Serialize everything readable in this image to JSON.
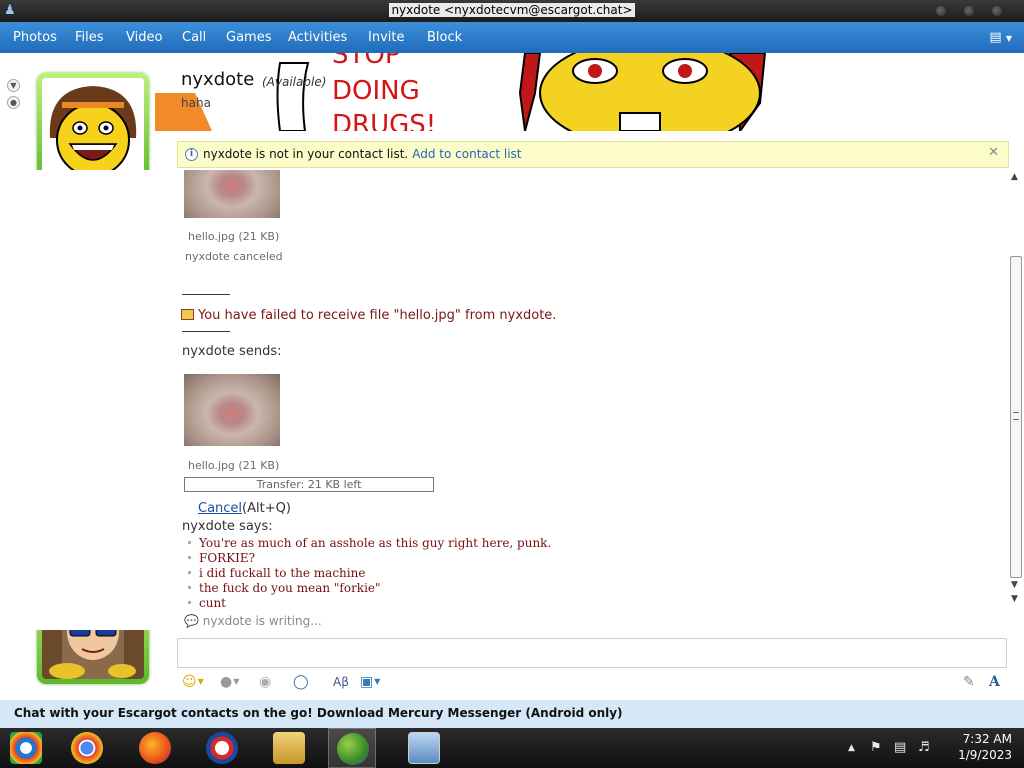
{
  "window": {
    "title": "nyxdote <nyxdotecvm@escargot.chat>"
  },
  "menu": {
    "items": [
      "Photos",
      "Files",
      "Video",
      "Call",
      "Games",
      "Activities",
      "Invite",
      "Block"
    ]
  },
  "contact": {
    "name": "nyxdote",
    "status": "(Available)",
    "personal_message": "haha"
  },
  "infobar": {
    "text": "nyxdote is not in your contact list.",
    "link": "Add to contact list"
  },
  "conversation": {
    "first_file": {
      "name": "hello.jpg (21 KB)",
      "status": "nyxdote canceled"
    },
    "error": "You have failed to receive file \"hello.jpg\" from nyxdote.",
    "sends_label": "nyxdote sends:",
    "second_file": {
      "name": "hello.jpg (21 KB)",
      "progress": "Transfer: 21 KB left"
    },
    "cancel_link": "Cancel",
    "cancel_shortcut": "(Alt+Q)",
    "says_label": "nyxdote says:",
    "messages": [
      "You're as much of an asshole as this guy right here, punk.",
      "FORKIE?",
      "i did fuckall to the machine",
      "the fuck do you mean \"forkie\"",
      "cunt"
    ],
    "typing": "nyxdote is writing..."
  },
  "banner_text": {
    "line1": "STOP",
    "line2": "DOING",
    "line3": "DRUGS!"
  },
  "promo": {
    "text": "Chat with your Escargot contacts on the go! Download Mercury Messenger (Android only)"
  },
  "taskbar": {
    "time": "7:32 AM",
    "date": "1/9/2023"
  },
  "colors": {
    "menu_blue": "#2a7bcc",
    "message_red": "#7a0e0e",
    "info_yellow": "#fcfcc9",
    "avatar_green": "#5db82a"
  }
}
